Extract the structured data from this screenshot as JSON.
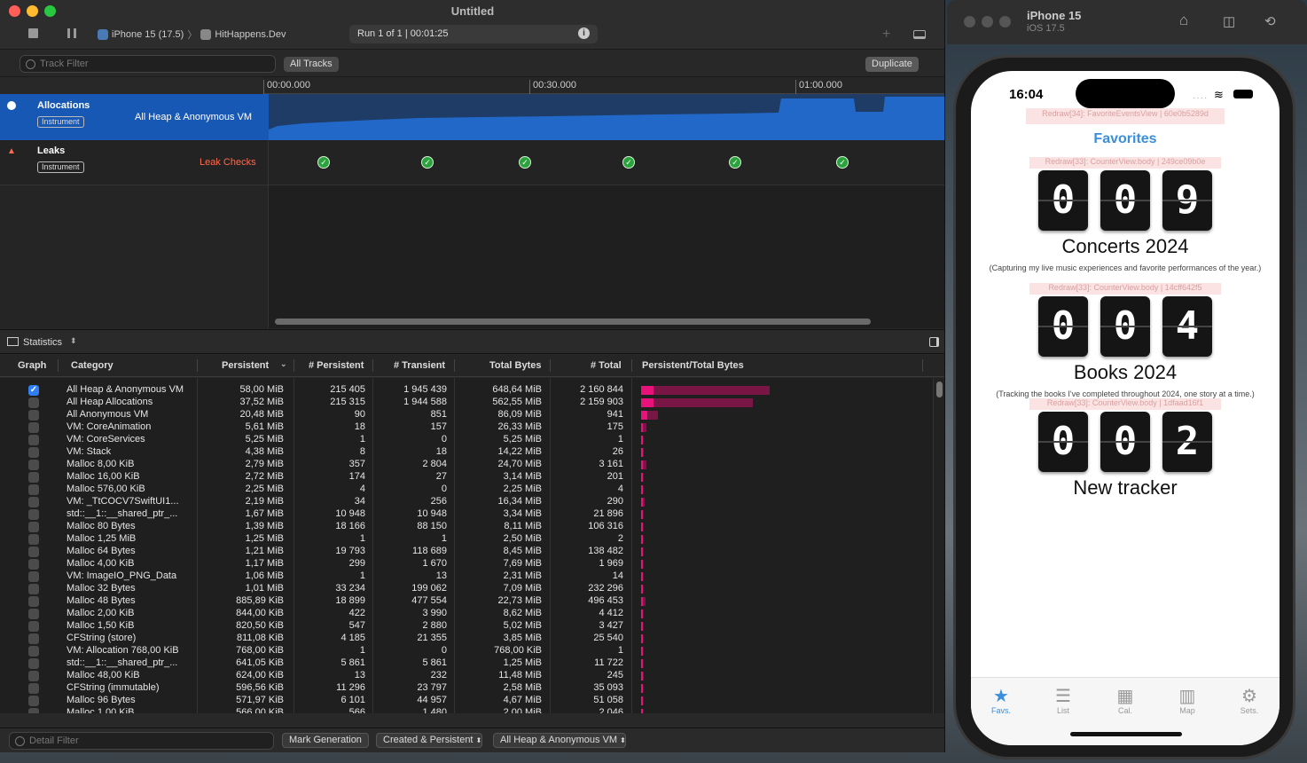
{
  "window": {
    "title": "Untitled"
  },
  "toolbar": {
    "device": "iPhone 15 (17.5)",
    "separator": "〉",
    "target": "HitHappens.Dev",
    "run": "Run 1 of 1  |  00:01:25"
  },
  "filters": {
    "track_filter_placeholder": "Track Filter",
    "all_tracks": "All Tracks",
    "duplicate": "Duplicate"
  },
  "ruler": [
    "00:00.000",
    "00:30.000",
    "01:00.000"
  ],
  "tracks": [
    {
      "name": "Allocations",
      "badge": "Instrument",
      "sub": "All Heap & Anonymous VM"
    },
    {
      "name": "Leaks",
      "badge": "Instrument",
      "sub": "Leak Checks"
    }
  ],
  "stats_label": "Statistics",
  "columns": [
    "Graph",
    "Category",
    "Persistent",
    "# Persistent",
    "# Transient",
    "Total Bytes",
    "# Total",
    "Persistent/Total Bytes"
  ],
  "rows": [
    {
      "cat": "All Heap & Anonymous VM",
      "p": "58,00 MiB",
      "np": "215 405",
      "nt": "1 945 439",
      "tb": "648,64 MiB",
      "tot": "2 160 844",
      "checked": true,
      "pr": 0.4,
      "tr": 1.0
    },
    {
      "cat": "All Heap Allocations",
      "p": "37,52 MiB",
      "np": "215 315",
      "nt": "1 944 588",
      "tb": "562,55 MiB",
      "tot": "2 159 903",
      "checked": false,
      "pr": 0.3,
      "tr": 0.87
    },
    {
      "cat": "All Anonymous VM",
      "p": "20,48 MiB",
      "np": "90",
      "nt": "851",
      "tb": "86,09 MiB",
      "tot": "941",
      "checked": false,
      "pr": 0.05,
      "tr": 0.13
    },
    {
      "cat": "VM: CoreAnimation",
      "p": "5,61 MiB",
      "np": "18",
      "nt": "157",
      "tb": "26,33 MiB",
      "tot": "175",
      "checked": false,
      "pr": 0.01,
      "tr": 0.04
    },
    {
      "cat": "VM: CoreServices",
      "p": "5,25 MiB",
      "np": "1",
      "nt": "0",
      "tb": "5,25 MiB",
      "tot": "1",
      "checked": false,
      "pr": 0.01,
      "tr": 0.01
    },
    {
      "cat": "VM: Stack",
      "p": "4,38 MiB",
      "np": "8",
      "nt": "18",
      "tb": "14,22 MiB",
      "tot": "26",
      "checked": false,
      "pr": 0.01,
      "tr": 0.02
    },
    {
      "cat": "Malloc 8,00 KiB",
      "p": "2,79 MiB",
      "np": "357",
      "nt": "2 804",
      "tb": "24,70 MiB",
      "tot": "3 161",
      "checked": false,
      "pr": 0.01,
      "tr": 0.04
    },
    {
      "cat": "Malloc 16,00 KiB",
      "p": "2,72 MiB",
      "np": "174",
      "nt": "27",
      "tb": "3,14 MiB",
      "tot": "201",
      "checked": false,
      "pr": 0.005,
      "tr": 0.01
    },
    {
      "cat": "Malloc 576,00 KiB",
      "p": "2,25 MiB",
      "np": "4",
      "nt": "0",
      "tb": "2,25 MiB",
      "tot": "4",
      "checked": false,
      "pr": 0.005,
      "tr": 0.005
    },
    {
      "cat": "VM: _TtCOCV7SwiftUI1...",
      "p": "2,19 MiB",
      "np": "34",
      "nt": "256",
      "tb": "16,34 MiB",
      "tot": "290",
      "checked": false,
      "pr": 0.005,
      "tr": 0.025
    },
    {
      "cat": "std::__1::__shared_ptr_...",
      "p": "1,67 MiB",
      "np": "10 948",
      "nt": "10 948",
      "tb": "3,34 MiB",
      "tot": "21 896",
      "checked": false,
      "pr": 0.005,
      "tr": 0.01
    },
    {
      "cat": "Malloc 80 Bytes",
      "p": "1,39 MiB",
      "np": "18 166",
      "nt": "88 150",
      "tb": "8,11 MiB",
      "tot": "106 316",
      "checked": false,
      "pr": 0.005,
      "tr": 0.015
    },
    {
      "cat": "Malloc 1,25 MiB",
      "p": "1,25 MiB",
      "np": "1",
      "nt": "1",
      "tb": "2,50 MiB",
      "tot": "2",
      "checked": false,
      "pr": 0.005,
      "tr": 0.005
    },
    {
      "cat": "Malloc 64 Bytes",
      "p": "1,21 MiB",
      "np": "19 793",
      "nt": "118 689",
      "tb": "8,45 MiB",
      "tot": "138 482",
      "checked": false,
      "pr": 0.005,
      "tr": 0.015
    },
    {
      "cat": "Malloc 4,00 KiB",
      "p": "1,17 MiB",
      "np": "299",
      "nt": "1 670",
      "tb": "7,69 MiB",
      "tot": "1 969",
      "checked": false,
      "pr": 0.005,
      "tr": 0.012
    },
    {
      "cat": "VM: ImageIO_PNG_Data",
      "p": "1,06 MiB",
      "np": "1",
      "nt": "13",
      "tb": "2,31 MiB",
      "tot": "14",
      "checked": false,
      "pr": 0.005,
      "tr": 0.005
    },
    {
      "cat": "Malloc 32 Bytes",
      "p": "1,01 MiB",
      "np": "33 234",
      "nt": "199 062",
      "tb": "7,09 MiB",
      "tot": "232 296",
      "checked": false,
      "pr": 0.005,
      "tr": 0.012
    },
    {
      "cat": "Malloc 48 Bytes",
      "p": "885,89 KiB",
      "np": "18 899",
      "nt": "477 554",
      "tb": "22,73 MiB",
      "tot": "496 453",
      "checked": false,
      "pr": 0.005,
      "tr": 0.035
    },
    {
      "cat": "Malloc 2,00 KiB",
      "p": "844,00 KiB",
      "np": "422",
      "nt": "3 990",
      "tb": "8,62 MiB",
      "tot": "4 412",
      "checked": false,
      "pr": 0.005,
      "tr": 0.014
    },
    {
      "cat": "Malloc 1,50 KiB",
      "p": "820,50 KiB",
      "np": "547",
      "nt": "2 880",
      "tb": "5,02 MiB",
      "tot": "3 427",
      "checked": false,
      "pr": 0.004,
      "tr": 0.008
    },
    {
      "cat": "CFString (store)",
      "p": "811,08 KiB",
      "np": "4 185",
      "nt": "21 355",
      "tb": "3,85 MiB",
      "tot": "25 540",
      "checked": false,
      "pr": 0.004,
      "tr": 0.006
    },
    {
      "cat": "VM: Allocation 768,00 KiB",
      "p": "768,00 KiB",
      "np": "1",
      "nt": "0",
      "tb": "768,00 KiB",
      "tot": "1",
      "checked": false,
      "pr": 0.004,
      "tr": 0.004
    },
    {
      "cat": "std::__1::__shared_ptr_...",
      "p": "641,05 KiB",
      "np": "5 861",
      "nt": "5 861",
      "tb": "1,25 MiB",
      "tot": "11 722",
      "checked": false,
      "pr": 0.003,
      "tr": 0.004
    },
    {
      "cat": "Malloc 48,00 KiB",
      "p": "624,00 KiB",
      "np": "13",
      "nt": "232",
      "tb": "11,48 MiB",
      "tot": "245",
      "checked": false,
      "pr": 0.003,
      "tr": 0.018
    },
    {
      "cat": "CFString (immutable)",
      "p": "596,56 KiB",
      "np": "11 296",
      "nt": "23 797",
      "tb": "2,58 MiB",
      "tot": "35 093",
      "checked": false,
      "pr": 0.003,
      "tr": 0.005
    },
    {
      "cat": "Malloc 96 Bytes",
      "p": "571,97 KiB",
      "np": "6 101",
      "nt": "44 957",
      "tb": "4,67 MiB",
      "tot": "51 058",
      "checked": false,
      "pr": 0.003,
      "tr": 0.008
    },
    {
      "cat": "Malloc 1,00 KiB",
      "p": "566,00 KiB",
      "np": "566",
      "nt": "1 480",
      "tb": "2,00 MiB",
      "tot": "2 046",
      "checked": false,
      "pr": 0.003,
      "tr": 0.004
    }
  ],
  "bottom": {
    "detail_filter": "Detail Filter",
    "mark_generation": "Mark Generation",
    "created_persistent": "Created & Persistent",
    "all_heap": "All Heap & Anonymous VM"
  },
  "simulator": {
    "name": "iPhone 15",
    "os": "iOS 17.5"
  },
  "app": {
    "time": "16:04",
    "redraw_fav": "Redraw[34]: FavoriteEventsView | 60e0b5289d",
    "title": "Favorites",
    "counters": [
      {
        "redraw": "Redraw[33]: CounterView.body | 249ce09b0e",
        "d1": "0",
        "d2": "0",
        "d3": "9",
        "name": "Concerts 2024",
        "desc": "(Capturing my live music experiences and favorite performances of the year.)"
      },
      {
        "redraw": "Redraw[33]: CounterView.body | 14cff642f5",
        "d1": "0",
        "d2": "0",
        "d3": "4",
        "name": "Books 2024",
        "desc": "(Tracking the books I've completed throughout 2024, one story at a time.)"
      },
      {
        "redraw": "Redraw[33]: CounterView.body | 1dfaad16f1",
        "d1": "0",
        "d2": "0",
        "d3": "2",
        "name": "New tracker",
        "desc": ""
      }
    ],
    "tabs": [
      {
        "label": "Favs.",
        "icon": "star-icon"
      },
      {
        "label": "List",
        "icon": "list-icon"
      },
      {
        "label": "Cal.",
        "icon": "calendar-icon"
      },
      {
        "label": "Map",
        "icon": "map-icon"
      },
      {
        "label": "Sets.",
        "icon": "gear-icon"
      }
    ],
    "accent": "#3a8edb"
  }
}
